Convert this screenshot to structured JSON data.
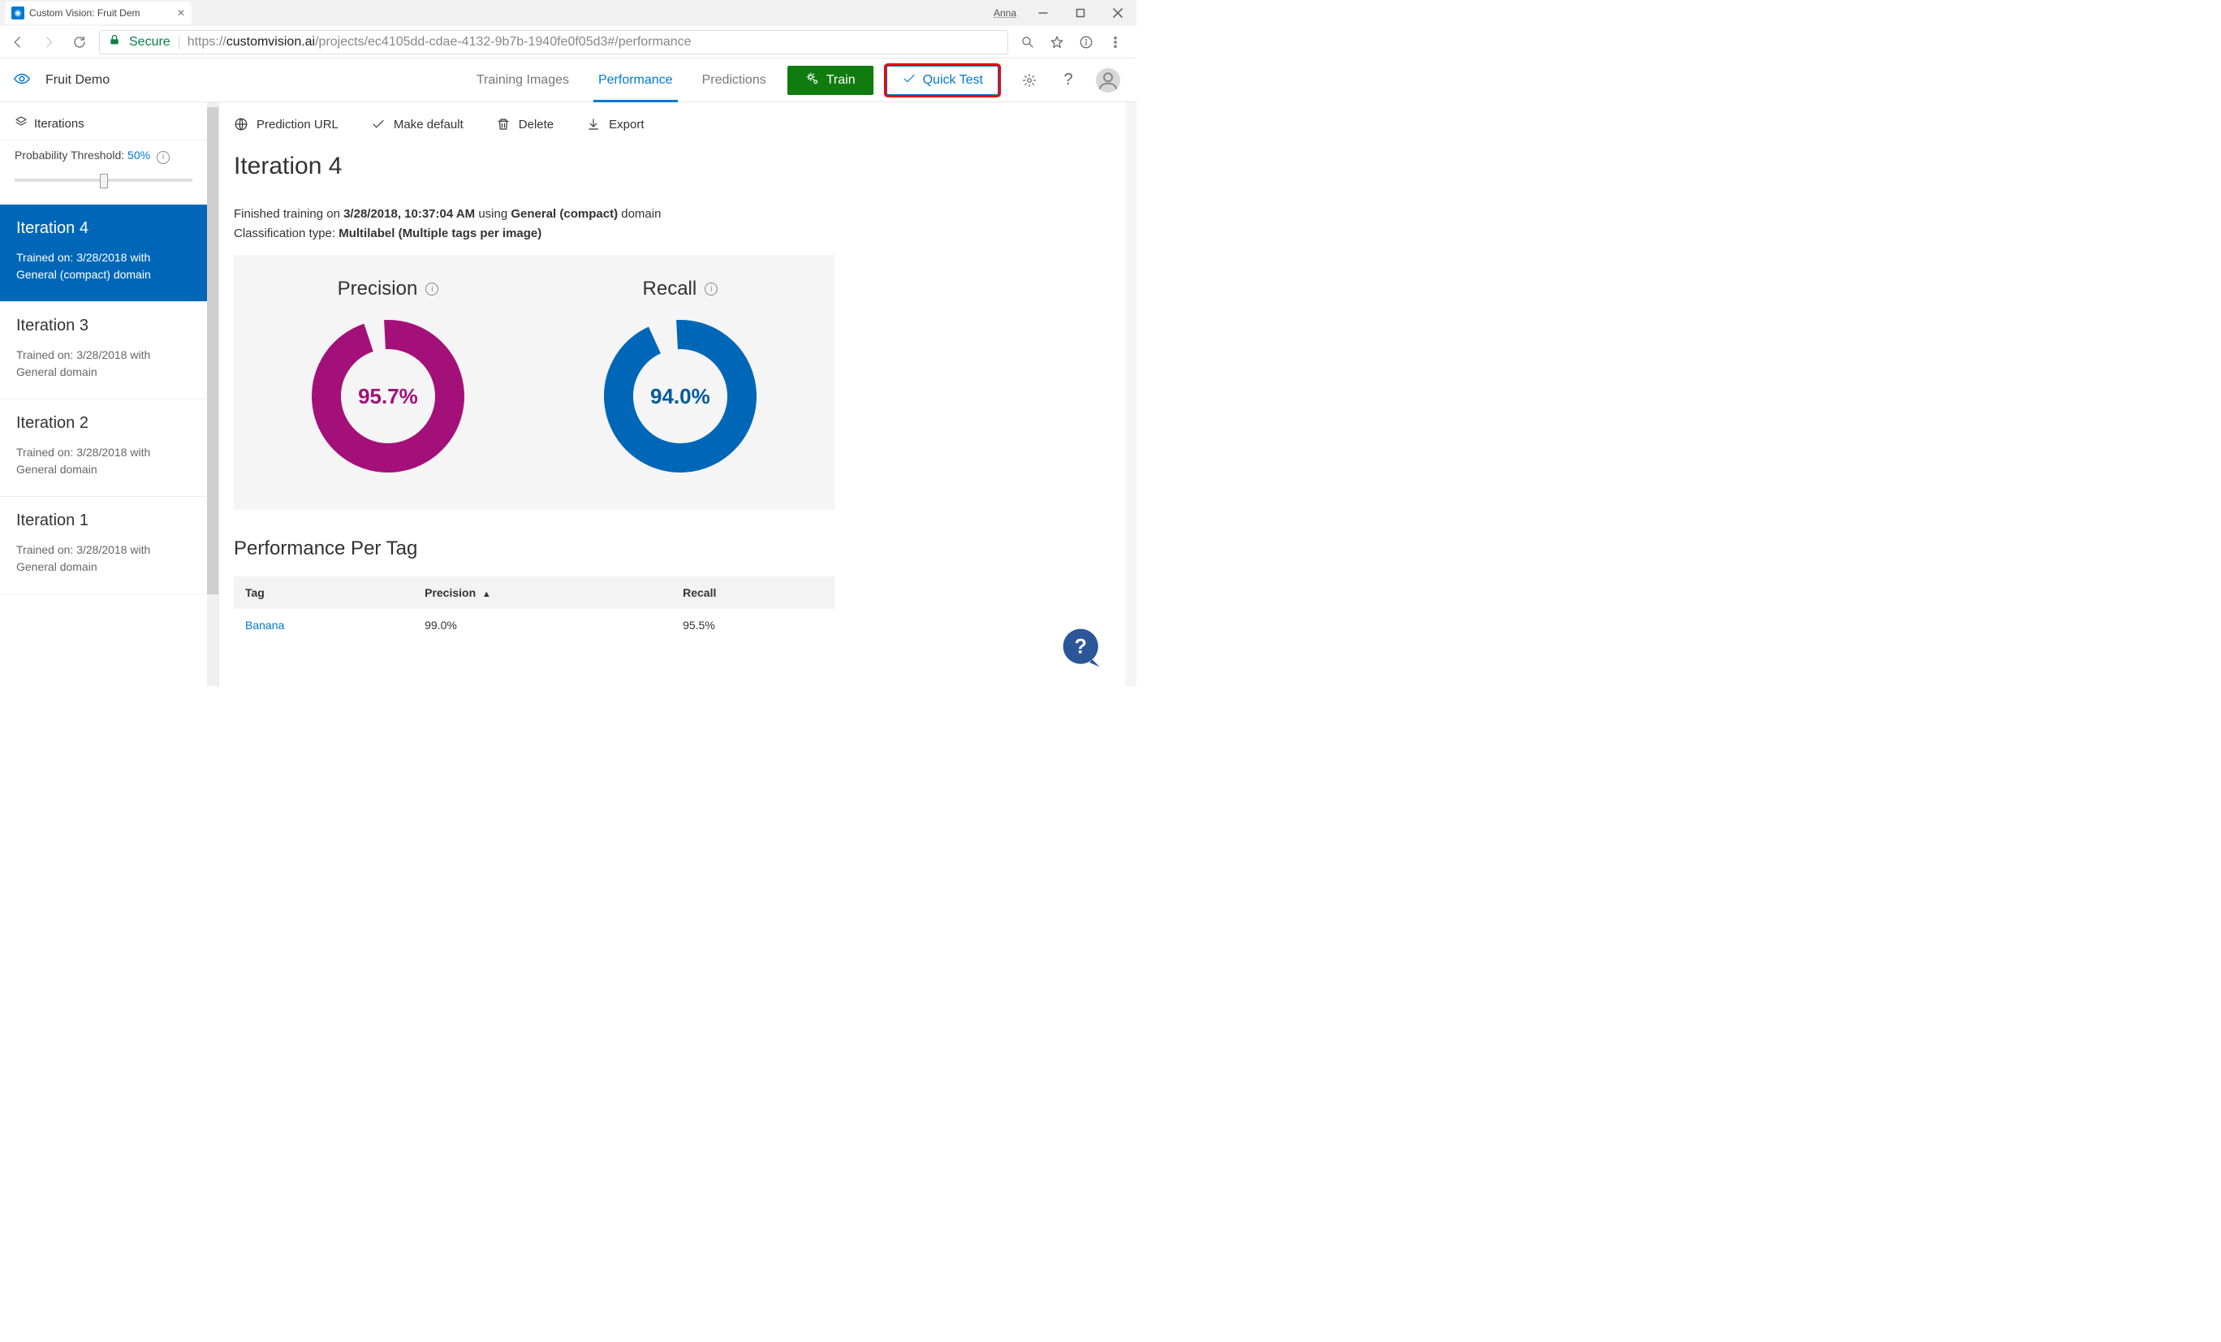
{
  "browser": {
    "tab_title": "Custom Vision: Fruit Dem",
    "user_name": "Anna",
    "secure_label": "Secure",
    "url_scheme": "https://",
    "url_host": "customvision.ai",
    "url_path": "/projects/ec4105dd-cdae-4132-9b7b-1940fe0f05d3#/performance"
  },
  "header": {
    "project_name": "Fruit Demo",
    "nav": {
      "training_images": "Training Images",
      "performance": "Performance",
      "predictions": "Predictions"
    },
    "train_label": "Train",
    "quick_test_label": "Quick Test"
  },
  "sidebar": {
    "iterations_label": "Iterations",
    "threshold_label": "Probability Threshold:",
    "threshold_value": "50%",
    "items": [
      {
        "title": "Iteration 4",
        "sub": "Trained on: 3/28/2018 with General (compact) domain"
      },
      {
        "title": "Iteration 3",
        "sub": "Trained on: 3/28/2018 with General domain"
      },
      {
        "title": "Iteration 2",
        "sub": "Trained on: 3/28/2018 with General domain"
      },
      {
        "title": "Iteration 1",
        "sub": "Trained on: 3/28/2018 with General domain"
      }
    ]
  },
  "actions": {
    "prediction_url": "Prediction URL",
    "make_default": "Make default",
    "delete": "Delete",
    "export": "Export"
  },
  "page": {
    "title": "Iteration 4",
    "status_prefix": "Finished training on ",
    "status_time": "3/28/2018, 10:37:04 AM",
    "status_mid": " using ",
    "status_domain": "General (compact)",
    "status_suffix": " domain",
    "class_prefix": "Classification type: ",
    "class_type": "Multilabel (Multiple tags per image)",
    "metrics": {
      "precision_label": "Precision",
      "recall_label": "Recall"
    },
    "perf_per_tag": "Performance Per Tag",
    "table": {
      "h_tag": "Tag",
      "h_precision": "Precision",
      "h_recall": "Recall",
      "rows": [
        {
          "tag": "Banana",
          "precision": "99.0%",
          "recall": "95.5%"
        }
      ]
    }
  },
  "chart_data": [
    {
      "type": "pie",
      "title": "Precision",
      "values": [
        95.7,
        4.3
      ],
      "value_label": "95.7%",
      "color": "#a4107a"
    },
    {
      "type": "pie",
      "title": "Recall",
      "values": [
        94.0,
        6.0
      ],
      "value_label": "94.0%",
      "color": "#0067b8"
    }
  ]
}
